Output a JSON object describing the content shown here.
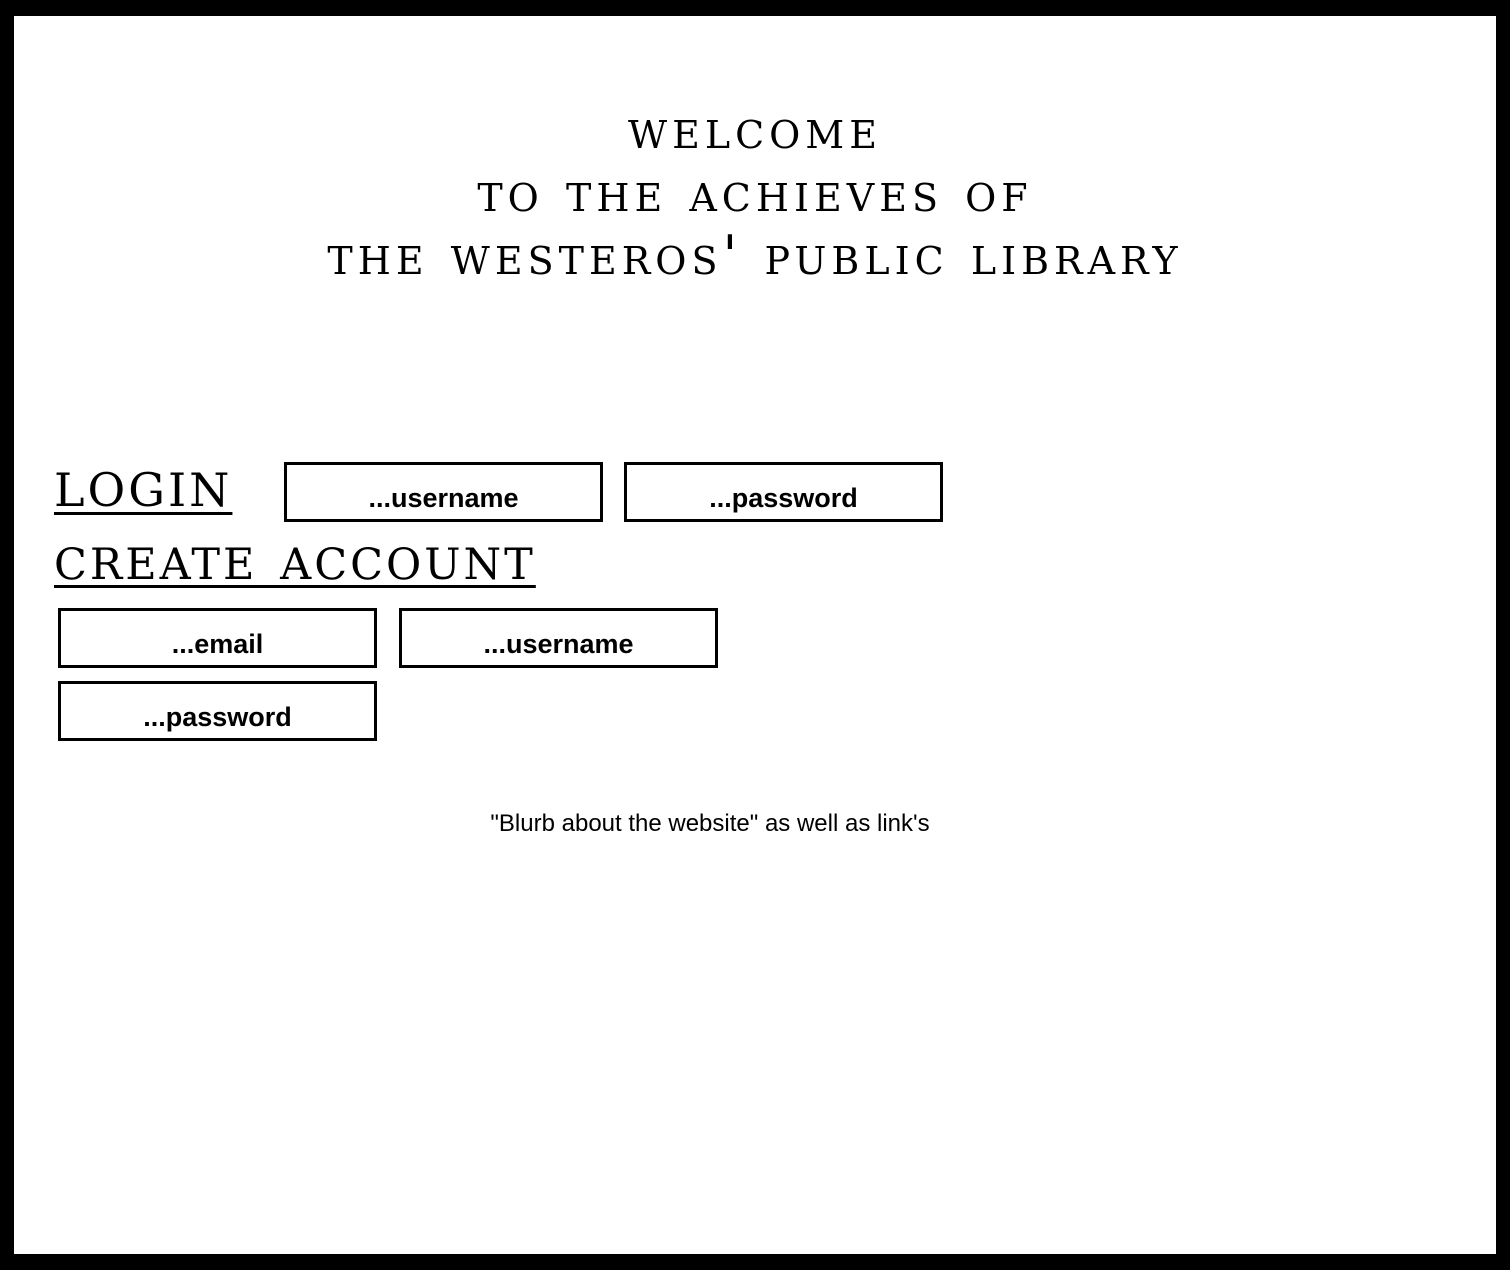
{
  "header": {
    "title_lines": [
      "Welcome",
      "to the Achieves of",
      "The Westeros' Public Library"
    ]
  },
  "login": {
    "heading": "Login",
    "username_placeholder": "...username",
    "password_placeholder": "...password"
  },
  "create_account": {
    "heading": "Create Account",
    "email_placeholder": "...email",
    "username_placeholder": "...username",
    "password_placeholder": "...password"
  },
  "footer": {
    "blurb": "\"Blurb about the website\" as well as link's"
  },
  "colors": {
    "background": "#ffffff",
    "frame": "#000000",
    "text": "#000000"
  }
}
